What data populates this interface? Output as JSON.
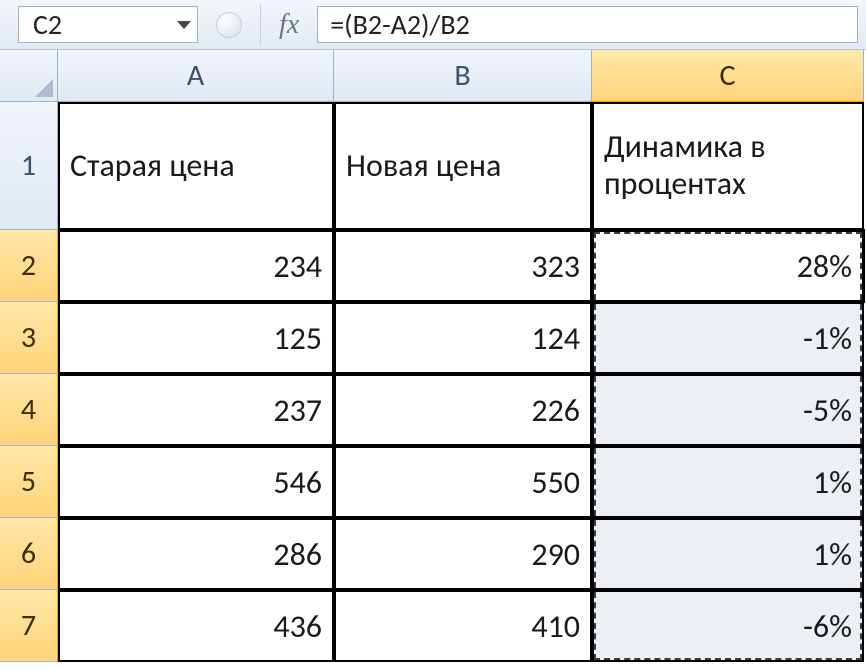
{
  "formula_bar": {
    "name_box": "C2",
    "fx_label": "fx",
    "formula": "=(B2-A2)/B2"
  },
  "columns": [
    "A",
    "B",
    "C"
  ],
  "headers": {
    "A": "Старая цена",
    "B": "Новая цена",
    "C": "Динамика в процентах"
  },
  "rows": [
    {
      "n": 2,
      "A": "234",
      "B": "323",
      "C": "28%"
    },
    {
      "n": 3,
      "A": "125",
      "B": "124",
      "C": "-1%"
    },
    {
      "n": 4,
      "A": "237",
      "B": "226",
      "C": "-5%"
    },
    {
      "n": 5,
      "A": "546",
      "B": "550",
      "C": "1%"
    },
    {
      "n": 6,
      "A": "286",
      "B": "290",
      "C": "1%"
    },
    {
      "n": 7,
      "A": "436",
      "B": "410",
      "C": "-6%"
    }
  ],
  "active_cell": "C2",
  "selected_range": "C2:C7"
}
